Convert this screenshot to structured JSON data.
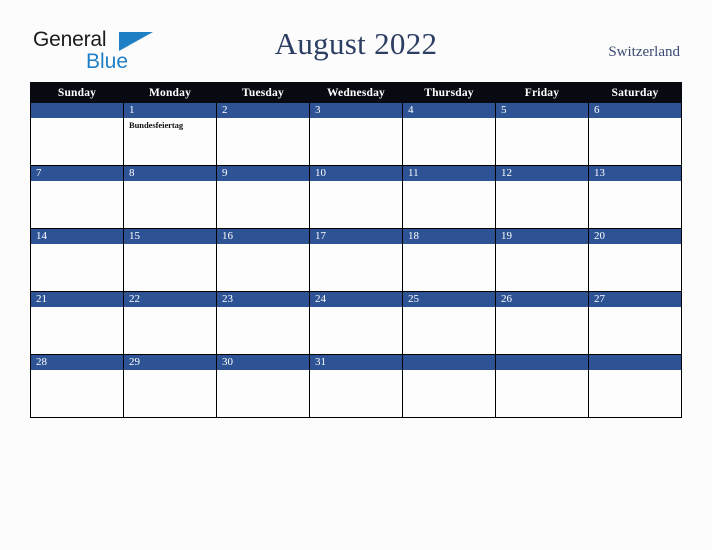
{
  "brand": {
    "name_top": "General",
    "name_bottom": "Blue",
    "triangle_icon": "blue-triangle-icon",
    "accent_blue": "#1f7fc4"
  },
  "header": {
    "title": "August 2022",
    "country": "Switzerland",
    "title_color": "#2c3e63"
  },
  "calendar": {
    "header_bg": "#070a10",
    "date_band_bg": "#2e5395",
    "cell_bg": "#fdfdfd",
    "weekday_headers": [
      "Sunday",
      "Monday",
      "Tuesday",
      "Wednesday",
      "Thursday",
      "Friday",
      "Saturday"
    ],
    "weeks": [
      [
        {
          "date": "",
          "events": []
        },
        {
          "date": "1",
          "events": [
            "Bundesfeiertag"
          ]
        },
        {
          "date": "2",
          "events": []
        },
        {
          "date": "3",
          "events": []
        },
        {
          "date": "4",
          "events": []
        },
        {
          "date": "5",
          "events": []
        },
        {
          "date": "6",
          "events": []
        }
      ],
      [
        {
          "date": "7",
          "events": []
        },
        {
          "date": "8",
          "events": []
        },
        {
          "date": "9",
          "events": []
        },
        {
          "date": "10",
          "events": []
        },
        {
          "date": "11",
          "events": []
        },
        {
          "date": "12",
          "events": []
        },
        {
          "date": "13",
          "events": []
        }
      ],
      [
        {
          "date": "14",
          "events": []
        },
        {
          "date": "15",
          "events": []
        },
        {
          "date": "16",
          "events": []
        },
        {
          "date": "17",
          "events": []
        },
        {
          "date": "18",
          "events": []
        },
        {
          "date": "19",
          "events": []
        },
        {
          "date": "20",
          "events": []
        }
      ],
      [
        {
          "date": "21",
          "events": []
        },
        {
          "date": "22",
          "events": []
        },
        {
          "date": "23",
          "events": []
        },
        {
          "date": "24",
          "events": []
        },
        {
          "date": "25",
          "events": []
        },
        {
          "date": "26",
          "events": []
        },
        {
          "date": "27",
          "events": []
        }
      ],
      [
        {
          "date": "28",
          "events": []
        },
        {
          "date": "29",
          "events": []
        },
        {
          "date": "30",
          "events": []
        },
        {
          "date": "31",
          "events": []
        },
        {
          "date": "",
          "events": []
        },
        {
          "date": "",
          "events": []
        },
        {
          "date": "",
          "events": []
        }
      ]
    ]
  }
}
